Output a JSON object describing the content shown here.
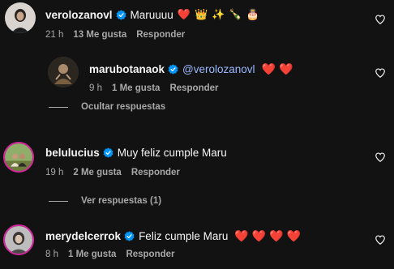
{
  "comments": [
    {
      "username": "verolozanovl",
      "text": "Maruuuu",
      "emojis": [
        "❤️",
        "👑",
        "✨",
        "🍾",
        "🎂"
      ],
      "time": "21 h",
      "likes": "13 Me gusta",
      "reply": "Responder"
    },
    {
      "username": "marubotanaok",
      "mention": "@verolozanovl",
      "hearts": [
        "❤️",
        "❤️"
      ],
      "time": "9 h",
      "likes": "1 Me gusta",
      "reply": "Responder"
    },
    {
      "username": "belulucius",
      "text": "Muy feliz cumple Maru",
      "time": "19 h",
      "likes": "2 Me gusta",
      "reply": "Responder"
    },
    {
      "username": "merydelcerrok",
      "text": "Feliz cumple Maru",
      "hearts": [
        "❤️",
        "❤️",
        "❤️",
        "❤️"
      ],
      "time": "8 h",
      "likes": "1 Me gusta",
      "reply": "Responder"
    }
  ],
  "toggles": {
    "hide_replies": "Ocultar respuestas",
    "view_replies": "Ver respuestas (1)"
  },
  "colors": {
    "background": "#121212",
    "verified": "#0095f6",
    "heart": "#ff3040",
    "secondary_text": "#a8a8a8"
  }
}
